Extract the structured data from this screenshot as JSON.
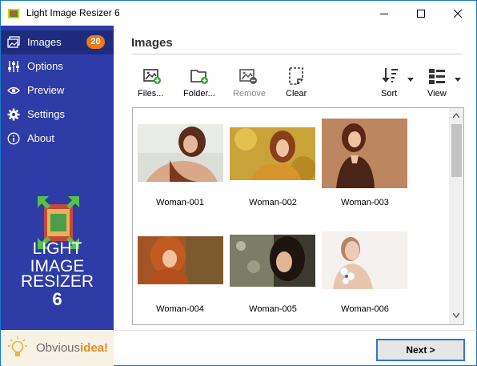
{
  "window": {
    "title": "Light Image Resizer 6"
  },
  "sidebar": {
    "items": [
      {
        "label": "Images",
        "icon": "images-icon",
        "badge": "20",
        "active": true
      },
      {
        "label": "Options",
        "icon": "sliders-icon"
      },
      {
        "label": "Preview",
        "icon": "eye-icon"
      },
      {
        "label": "Settings",
        "icon": "gear-icon"
      },
      {
        "label": "About",
        "icon": "info-icon"
      }
    ],
    "logo": {
      "line1": "LIGHT",
      "line2": "IMAGE",
      "line3": "RESIZER",
      "version": "6"
    },
    "brand": {
      "part1": "Obvious",
      "part2": "idea",
      "part3": "!"
    }
  },
  "main": {
    "title": "Images",
    "toolbar": {
      "files": "Files...",
      "folder": "Folder...",
      "remove": "Remove",
      "clear": "Clear",
      "sort": "Sort",
      "view": "View"
    },
    "images": [
      {
        "name": "Woman-001"
      },
      {
        "name": "Woman-002"
      },
      {
        "name": "Woman-003"
      },
      {
        "name": "Woman-004"
      },
      {
        "name": "Woman-005"
      },
      {
        "name": "Woman-006"
      }
    ]
  },
  "footer": {
    "next": "Next >"
  },
  "colors": {
    "sidebar": "#2d3ca6",
    "sidebar_active": "#1f2c7e",
    "badge": "#ea7a1c",
    "accent": "#2b79c9"
  }
}
